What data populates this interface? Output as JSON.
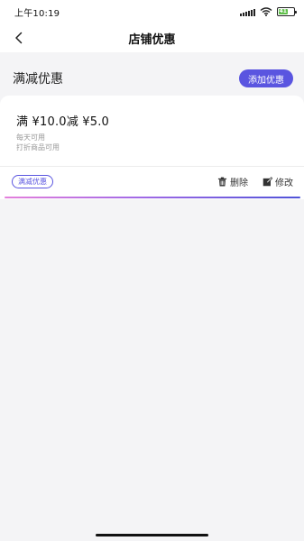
{
  "status_bar": {
    "time": "上午10:19",
    "battery_level": "41"
  },
  "nav": {
    "title": "店铺优惠"
  },
  "section": {
    "title": "满减优惠",
    "add_button_label": "添加优惠"
  },
  "coupon": {
    "amount_text": "满 ¥10.0减 ¥5.0",
    "availability_line1": "每天可用",
    "availability_line2": "打折商品可用",
    "tag": "满减优惠",
    "delete_label": "删除",
    "edit_label": "修改"
  },
  "colors": {
    "accent": "#5a55e0",
    "page_background": "#f4f4f6"
  }
}
